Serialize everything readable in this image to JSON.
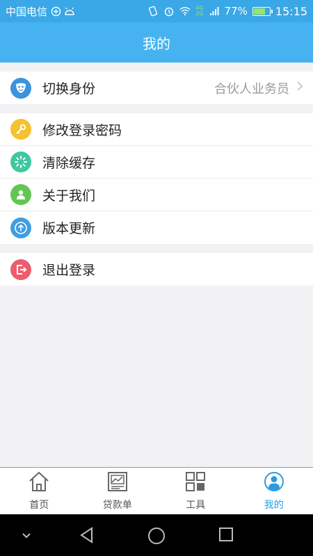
{
  "status_bar": {
    "carrier": "中国电信",
    "battery_percent": "77%",
    "battery_level": 0.77,
    "network_top": "4G",
    "network_bottom": "2G",
    "time": "15:15"
  },
  "header": {
    "title": "我的"
  },
  "groups": [
    {
      "items": [
        {
          "label": "切换身份",
          "value": "合伙人业务员",
          "icon": "mask-icon",
          "color": "#3a94dd"
        }
      ]
    },
    {
      "items": [
        {
          "label": "修改登录密码",
          "icon": "key-icon",
          "color": "#f5c131"
        },
        {
          "label": "清除缓存",
          "icon": "loading-icon",
          "color": "#3ec8a0"
        },
        {
          "label": "关于我们",
          "icon": "user-icon",
          "color": "#62c653"
        },
        {
          "label": "版本更新",
          "icon": "upload-icon",
          "color": "#3f9fe2"
        }
      ]
    },
    {
      "items": [
        {
          "label": "退出登录",
          "icon": "logout-icon",
          "color": "#ec5d6e"
        }
      ]
    }
  ],
  "tabs": [
    {
      "label": "首页",
      "icon": "home-icon",
      "active": false
    },
    {
      "label": "贷款单",
      "icon": "loan-chart-icon",
      "active": false
    },
    {
      "label": "工具",
      "icon": "grid-tools-icon",
      "active": false
    },
    {
      "label": "我的",
      "icon": "profile-icon",
      "active": true
    }
  ],
  "colors": {
    "header_bg": "#46b3f0",
    "status_bg": "#3aa7e6",
    "active_tab": "#2b9be0",
    "page_bg": "#f2f1f4"
  }
}
